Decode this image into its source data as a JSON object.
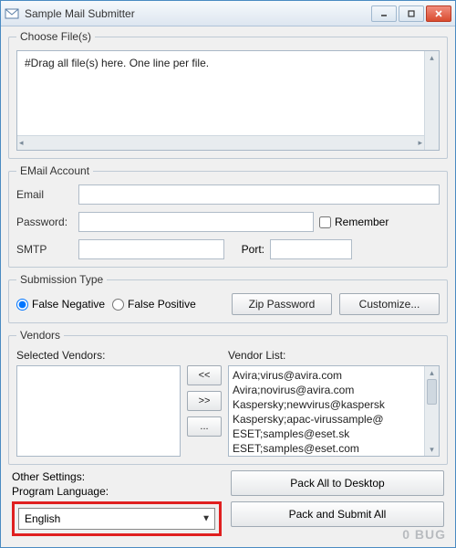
{
  "title": "Sample Mail Submitter",
  "choose_files": {
    "legend": "Choose File(s)",
    "placeholder": "#Drag all file(s) here. One line per file."
  },
  "email": {
    "legend": "EMail Account",
    "email_label": "Email",
    "password_label": "Password:",
    "remember_label": "Remember",
    "smtp_label": "SMTP",
    "port_label": "Port:"
  },
  "submission": {
    "legend": "Submission Type",
    "false_negative": "False Negative",
    "false_positive": "False Positive",
    "zip_password": "Zip Password",
    "customize": "Customize..."
  },
  "vendors": {
    "legend": "Vendors",
    "selected_label": "Selected Vendors:",
    "list_label": "Vendor List:",
    "move_left": "<<",
    "move_right": ">>",
    "more": "...",
    "items": [
      "Avira;virus@avira.com",
      "Avira;novirus@avira.com",
      "Kaspersky;newvirus@kaspersk",
      "Kaspersky;apac-virussample@",
      "ESET;samples@eset.sk",
      "ESET;samples@eset.com"
    ]
  },
  "other": {
    "title": "Other Settings:",
    "program_language_label": "Program Language:",
    "language": "English"
  },
  "actions": {
    "pack_desktop": "Pack All to Desktop",
    "pack_submit": "Pack and Submit All"
  },
  "watermark": "0 BUG"
}
